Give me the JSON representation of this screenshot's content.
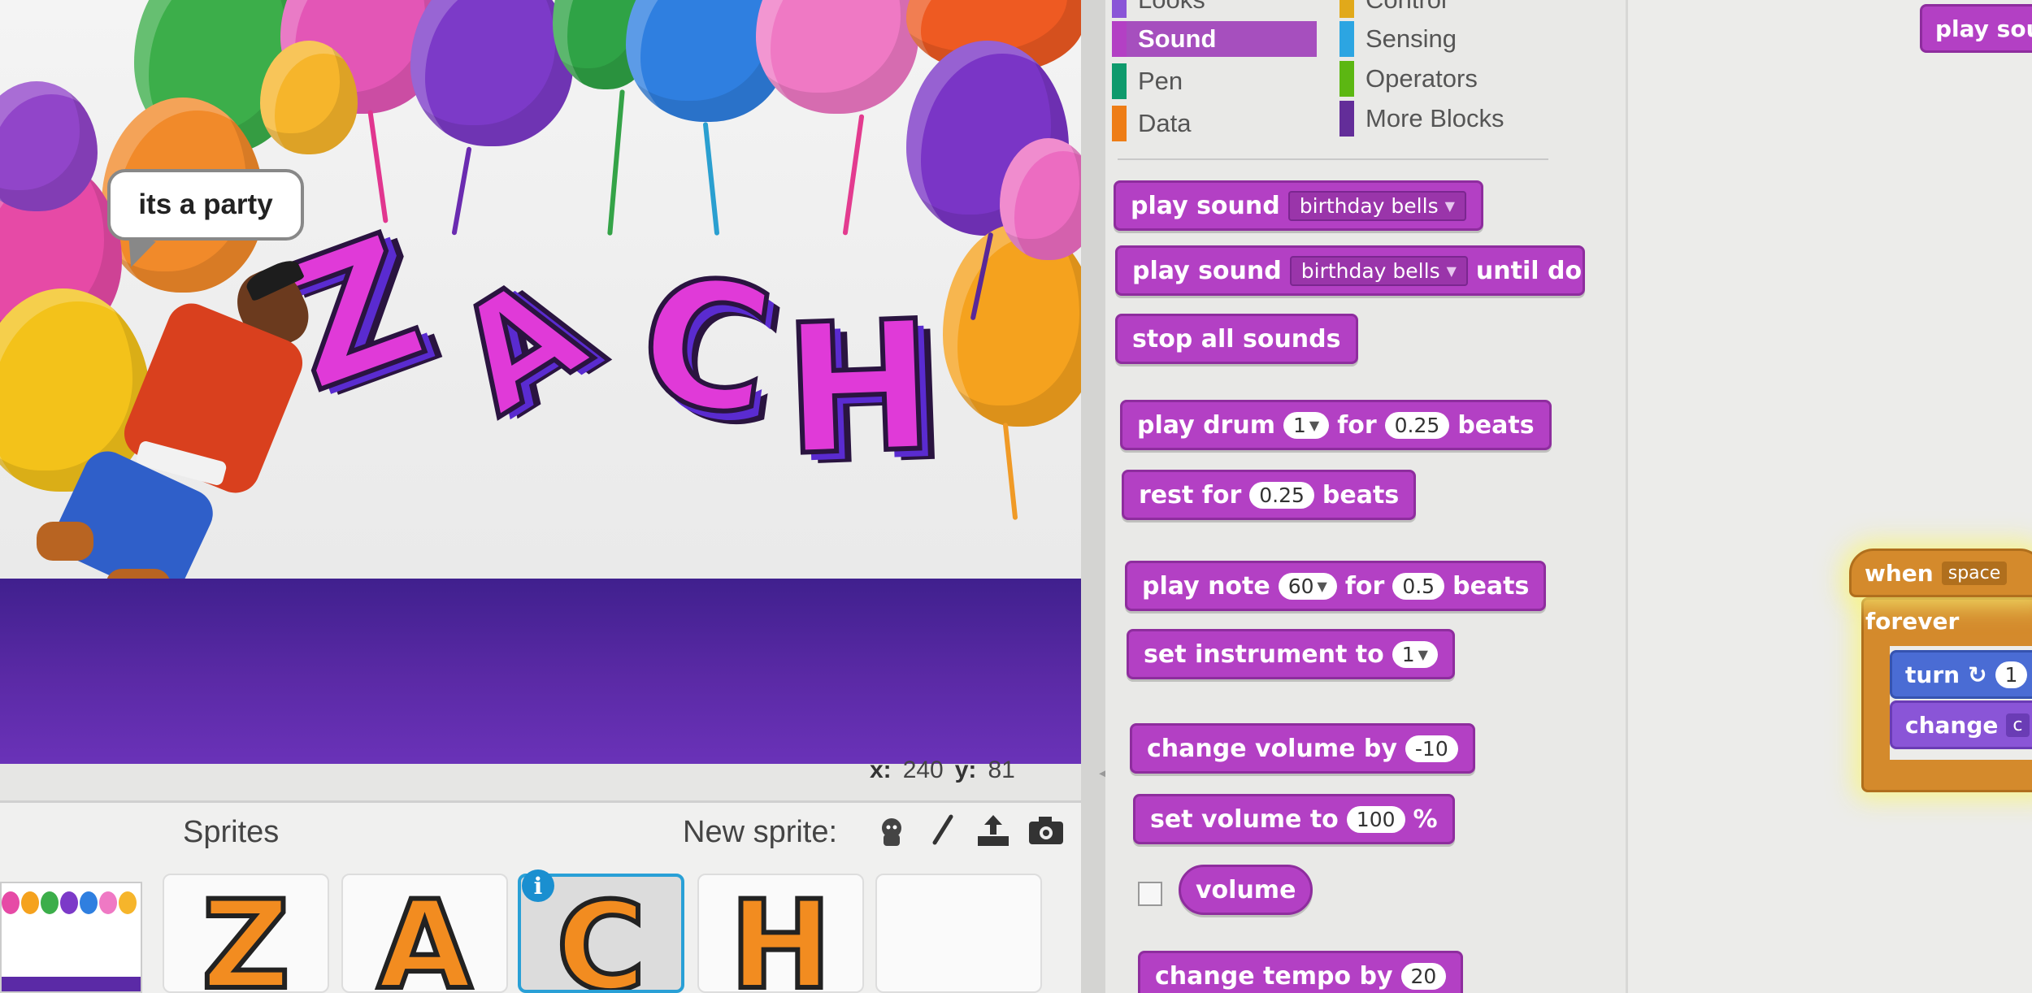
{
  "stage": {
    "speech_bubble": "its a party",
    "letters": [
      "Z",
      "A",
      "C",
      "H"
    ]
  },
  "coords": {
    "x_label": "x:",
    "x_value": "240",
    "y_label": "y:",
    "y_value": "81"
  },
  "sprites_pane": {
    "title": "Sprites",
    "new_sprite_label": "New sprite:",
    "new_sprite_icons": [
      "character-library-icon",
      "paint-brush-icon",
      "upload-icon",
      "camera-icon"
    ],
    "sprites": [
      "Z",
      "A",
      "C",
      "H"
    ],
    "selected_sprite": "C",
    "info_badge": "i"
  },
  "palette": {
    "categories_left": [
      {
        "label": "Looks",
        "color": "#8a55d7"
      },
      {
        "label": "Sound",
        "color": "#b340c4",
        "active": true
      },
      {
        "label": "Pen",
        "color": "#0e9a6c"
      },
      {
        "label": "Data",
        "color": "#ee7d16"
      }
    ],
    "categories_right": [
      {
        "label": "Control",
        "color": "#e1a91a"
      },
      {
        "label": "Sensing",
        "color": "#2ca5e2"
      },
      {
        "label": "Operators",
        "color": "#5cb712"
      },
      {
        "label": "More Blocks",
        "color": "#632d99"
      }
    ],
    "blocks": {
      "play_sound": {
        "label": "play sound",
        "dropdown": "birthday bells"
      },
      "play_sound_until": {
        "label": "play sound",
        "dropdown": "birthday bells",
        "suffix": "until do"
      },
      "stop_all_sounds": {
        "label": "stop all sounds"
      },
      "play_drum": {
        "label": "play drum",
        "drum": "1",
        "for": "for",
        "beats_value": "0.25",
        "beats": "beats"
      },
      "rest_for": {
        "label": "rest for",
        "value": "0.25",
        "beats": "beats"
      },
      "play_note": {
        "label": "play note",
        "note": "60",
        "for": "for",
        "beats_value": "0.5",
        "beats": "beats"
      },
      "set_instrument": {
        "label": "set instrument to",
        "value": "1"
      },
      "change_volume": {
        "label": "change volume by",
        "value": "-10"
      },
      "set_volume": {
        "label": "set volume to",
        "value": "100",
        "unit": "%"
      },
      "volume": {
        "label": "volume"
      },
      "change_tempo": {
        "label": "change tempo by",
        "value": "20"
      }
    }
  },
  "scripts": {
    "play_sound_partial": "play sou",
    "when_key": {
      "label": "when",
      "key": "space"
    },
    "forever": "forever",
    "turn": {
      "label": "turn",
      "value": "1"
    },
    "change": {
      "label": "change",
      "value": "c"
    }
  },
  "colors": {
    "sound": "#b340c4",
    "events": "#d48a2c",
    "motion": "#4a6cd4",
    "looks": "#8a55d7",
    "stage_floor": "#5b2aa6",
    "selection": "#29a0d6"
  }
}
